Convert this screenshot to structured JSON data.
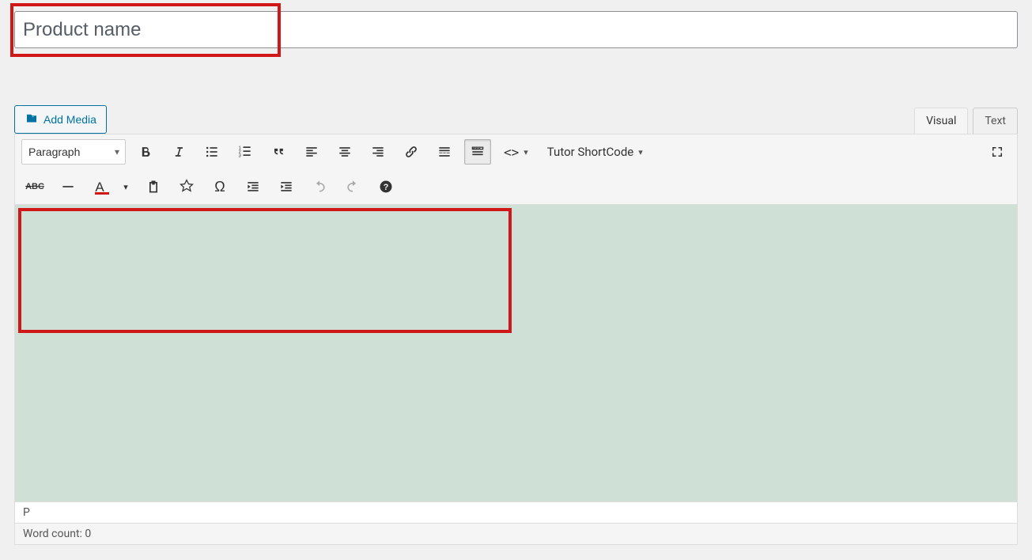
{
  "title": {
    "placeholder": "Product name",
    "value": ""
  },
  "media_button": {
    "label": "Add Media"
  },
  "tabs": {
    "visual": "Visual",
    "text": "Text"
  },
  "toolbar": {
    "format_selected": "Paragraph",
    "shortcode_label": "Tutor ShortCode"
  },
  "status": {
    "path": "P",
    "wordcount_label": "Word count:",
    "wordcount_value": "0"
  }
}
